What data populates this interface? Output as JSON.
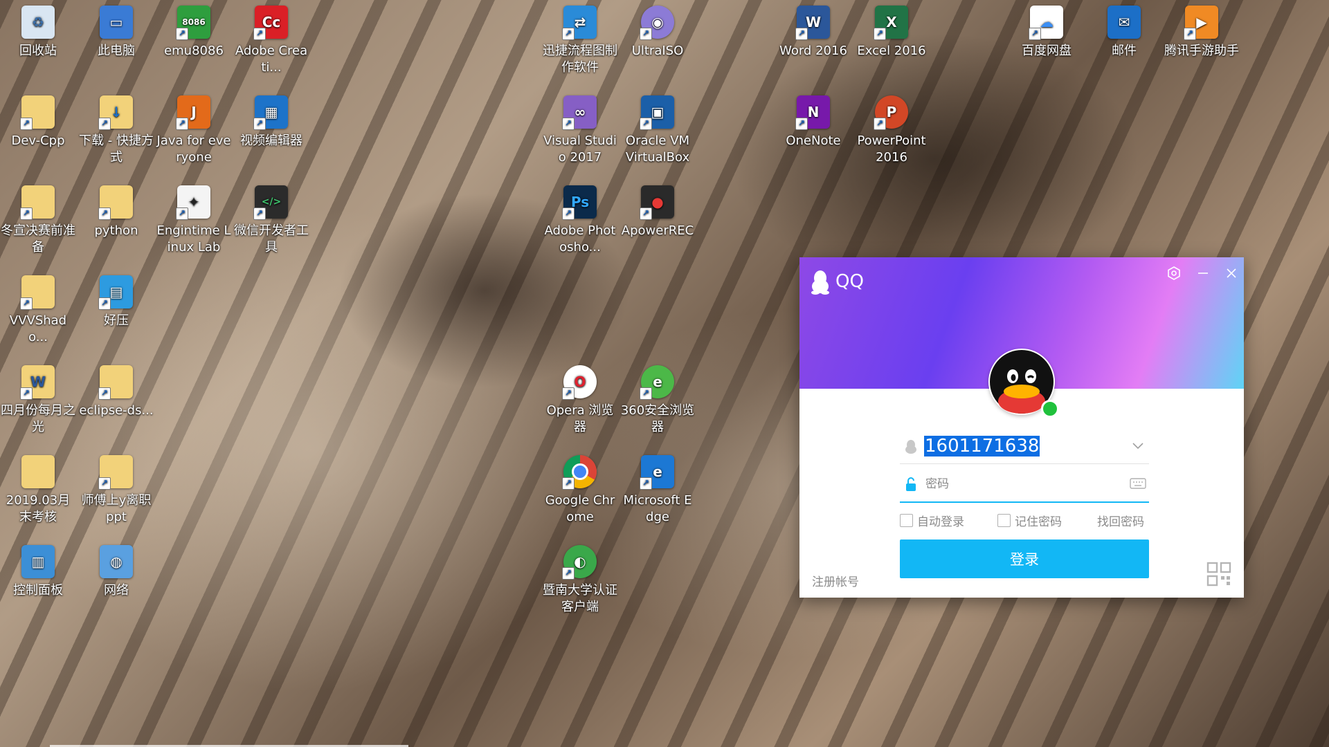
{
  "desktop_icons": [
    {
      "label": "回收站",
      "icon": "recycle-bin-icon",
      "color": "#d9e6f2",
      "glyph": "♻"
    },
    {
      "label": "此电脑",
      "icon": "computer-icon",
      "color": "#3a7bd5",
      "glyph": "🖥"
    },
    {
      "label": "emu8086",
      "icon": "chip-icon",
      "color": "#2e9e3e",
      "glyph": "8086"
    },
    {
      "label": "Adobe Creati...",
      "icon": "adobe-cc-icon",
      "color": "#da1f26",
      "glyph": "Cc"
    },
    {
      "label": "迅捷流程图制作软件",
      "icon": "flowchart-icon",
      "color": "#2a8bd8",
      "glyph": "⇄"
    },
    {
      "label": "UltraISO",
      "icon": "disc-icon",
      "color": "#8c7bd6",
      "glyph": "◉"
    },
    {
      "label": "Word 2016",
      "icon": "word-icon",
      "color": "#2b579a",
      "glyph": "W"
    },
    {
      "label": "Excel 2016",
      "icon": "excel-icon",
      "color": "#217346",
      "glyph": "X"
    },
    {
      "label": "百度网盘",
      "icon": "baidu-netdisk-icon",
      "color": "#3b8ff5",
      "glyph": "☁"
    },
    {
      "label": "邮件",
      "icon": "mail-icon",
      "color": "#1c6fc7",
      "glyph": "✉"
    },
    {
      "label": "腾讯手游助手",
      "icon": "tencent-game-icon",
      "color": "#f08a24",
      "glyph": "▶"
    },
    {
      "label": "Dev-Cpp",
      "icon": "folder-icon",
      "color": "#f2d27a",
      "glyph": ""
    },
    {
      "label": "下载 - 快捷方式",
      "icon": "download-folder-icon",
      "color": "#f2d27a",
      "glyph": "↓"
    },
    {
      "label": "Java for everyone",
      "icon": "java-book-icon",
      "color": "#e36a1a",
      "glyph": "J"
    },
    {
      "label": "视频编辑器",
      "icon": "video-editor-icon",
      "color": "#1d73c9",
      "glyph": "▦"
    },
    {
      "label": "Visual Studio 2017",
      "icon": "visual-studio-icon",
      "color": "#865fc5",
      "glyph": "∞"
    },
    {
      "label": "Oracle VM VirtualBox",
      "icon": "virtualbox-icon",
      "color": "#1b5fa8",
      "glyph": "▣"
    },
    {
      "label": "OneNote",
      "icon": "onenote-icon",
      "color": "#7719aa",
      "glyph": "N"
    },
    {
      "label": "PowerPoint 2016",
      "icon": "powerpoint-icon",
      "color": "#d24726",
      "glyph": "P"
    },
    {
      "label": "冬宣决赛前准备",
      "icon": "folder-icon",
      "color": "#f2d27a",
      "glyph": ""
    },
    {
      "label": "python",
      "icon": "folder-icon",
      "color": "#f2d27a",
      "glyph": ""
    },
    {
      "label": "Engintime Linux Lab",
      "icon": "linux-penguin-icon",
      "color": "#f4f4f4",
      "glyph": "🐧"
    },
    {
      "label": "微信开发者工具",
      "icon": "wechat-devtools-icon",
      "color": "#2b2b2b",
      "glyph": "</>"
    },
    {
      "label": "Adobe Photosho...",
      "icon": "photoshop-icon",
      "color": "#0b2a4a",
      "glyph": "Ps"
    },
    {
      "label": "ApowerREC",
      "icon": "record-icon",
      "color": "#2a2a2a",
      "glyph": "●"
    },
    {
      "label": "VVVShado...",
      "icon": "folder-icon",
      "color": "#f2d27a",
      "glyph": ""
    },
    {
      "label": "好压",
      "icon": "haozip-icon",
      "color": "#2d9be0",
      "glyph": "▤"
    },
    {
      "label": "Opera 浏览器",
      "icon": "opera-icon",
      "color": "#e0212f",
      "glyph": "O"
    },
    {
      "label": "360安全浏览器",
      "icon": "360-browser-icon",
      "color": "#4cb848",
      "glyph": "e"
    },
    {
      "label": "四月份每月之光",
      "icon": "word-doc-icon",
      "color": "#f2d27a",
      "glyph": "W"
    },
    {
      "label": "eclipse-ds...",
      "icon": "folder-icon",
      "color": "#f2d27a",
      "glyph": ""
    },
    {
      "label": "Google Chrome",
      "icon": "chrome-icon",
      "color": "#e8e8e8",
      "glyph": "◎"
    },
    {
      "label": "Microsoft Edge",
      "icon": "edge-icon",
      "color": "#1c78d4",
      "glyph": "e"
    },
    {
      "label": "2019.03月末考核",
      "icon": "folder-icon",
      "color": "#f2d27a",
      "glyph": ""
    },
    {
      "label": "师傅上y离职ppt",
      "icon": "folder-icon",
      "color": "#f2d27a",
      "glyph": ""
    },
    {
      "label": "暨南大学认证客户端",
      "icon": "jnu-client-icon",
      "color": "#3aa84a",
      "glyph": "◐"
    },
    {
      "label": "控制面板",
      "icon": "control-panel-icon",
      "color": "#3c8fd6",
      "glyph": "▥"
    },
    {
      "label": "网络",
      "icon": "network-icon",
      "color": "#5aa0e0",
      "glyph": "◍"
    }
  ],
  "qq": {
    "title": "QQ",
    "account": "1601171638",
    "password_placeholder": "密码",
    "auto_login": "自动登录",
    "remember_password": "记住密码",
    "find_password": "找回密码",
    "login": "登录",
    "register": "注册帐号",
    "colors": {
      "accent": "#12b7f5",
      "selection": "#0d6ee3",
      "online": "#20c13c"
    }
  }
}
